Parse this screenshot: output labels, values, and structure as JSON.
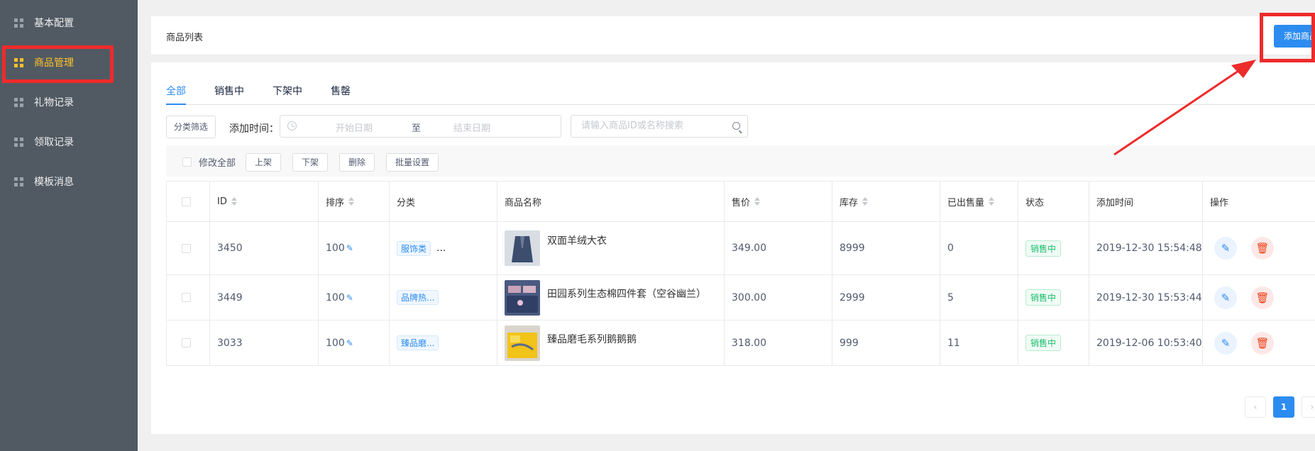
{
  "sidebar": {
    "items": [
      {
        "label": "基本配置",
        "active": false
      },
      {
        "label": "商品管理",
        "active": true
      },
      {
        "label": "礼物记录",
        "active": false
      },
      {
        "label": "领取记录",
        "active": false
      },
      {
        "label": "模板消息",
        "active": false
      }
    ]
  },
  "header": {
    "title": "商品列表",
    "add_button": "添加商品"
  },
  "tabs": [
    {
      "label": "全部",
      "active": true
    },
    {
      "label": "销售中",
      "active": false
    },
    {
      "label": "下架中",
      "active": false
    },
    {
      "label": "售罄",
      "active": false
    }
  ],
  "filters": {
    "category_button": "分类筛选",
    "time_label": "添加时间：",
    "start_placeholder": "开始日期",
    "to_text": "至",
    "end_placeholder": "结束日期",
    "search_placeholder": "请输入商品ID或名称搜索"
  },
  "batch": {
    "select_all_label": "修改全部",
    "buttons": [
      "上架",
      "下架",
      "删除",
      "批量设置"
    ]
  },
  "table": {
    "columns": [
      "ID",
      "排序",
      "分类",
      "商品名称",
      "售价",
      "库存",
      "已出售量",
      "状态",
      "添加时间",
      "操作"
    ],
    "rows": [
      {
        "id": "3450",
        "sort": "100",
        "category": "服饰类",
        "category_more": "...",
        "name": "双面羊绒大衣",
        "price": "349.00",
        "stock": "8999",
        "sold": "0",
        "status": "销售中",
        "time": "2019-12-30 15:54:48"
      },
      {
        "id": "3449",
        "sort": "100",
        "category": "品牌热...",
        "category_more": "",
        "name": "田园系列生态棉四件套（空谷幽兰）",
        "price": "300.00",
        "stock": "2999",
        "sold": "5",
        "status": "销售中",
        "time": "2019-12-30 15:53:44"
      },
      {
        "id": "3033",
        "sort": "100",
        "category": "臻品磨...",
        "category_more": "",
        "name": "臻品磨毛系列鹅鹅鹅",
        "price": "318.00",
        "stock": "999",
        "sold": "11",
        "status": "销售中",
        "time": "2019-12-06 10:53:40"
      }
    ]
  },
  "pagination": {
    "prev": "‹",
    "current": "1",
    "next": "›"
  },
  "colors": {
    "sidebar_bg": "#515a63",
    "active_nav": "#ffc12b",
    "primary": "#2d8cf0",
    "annotation_red": "#ee2b2b"
  }
}
